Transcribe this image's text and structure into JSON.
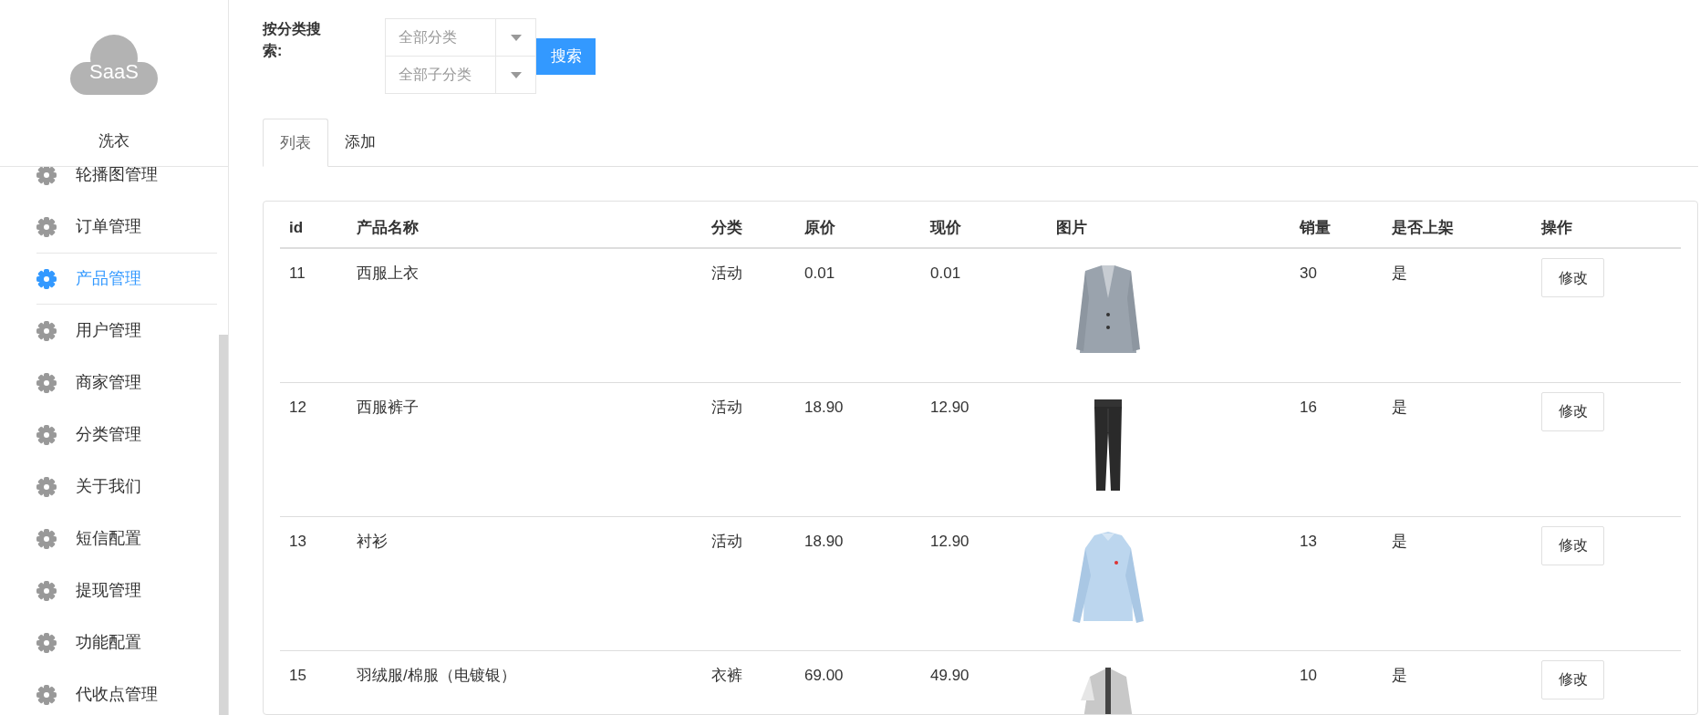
{
  "sidebar": {
    "logo_text": "SaaS",
    "brand": "洗衣",
    "items": [
      {
        "label": "轮播图管理",
        "selected": false
      },
      {
        "label": "订单管理",
        "selected": false
      },
      {
        "label": "产品管理",
        "selected": true
      },
      {
        "label": "用户管理",
        "selected": false
      },
      {
        "label": "商家管理",
        "selected": false
      },
      {
        "label": "分类管理",
        "selected": false
      },
      {
        "label": "关于我们",
        "selected": false
      },
      {
        "label": "短信配置",
        "selected": false
      },
      {
        "label": "提现管理",
        "selected": false
      },
      {
        "label": "功能配置",
        "selected": false
      },
      {
        "label": "代收点管理",
        "selected": false
      }
    ]
  },
  "search": {
    "label": "按分类搜索:",
    "selects": [
      {
        "value": "全部分类"
      },
      {
        "value": "全部子分类"
      }
    ],
    "button": "搜索"
  },
  "tabs": [
    {
      "label": "列表",
      "selected": true
    },
    {
      "label": "添加",
      "selected": false
    }
  ],
  "table": {
    "columns": [
      "id",
      "产品名称",
      "分类",
      "原价",
      "现价",
      "图片",
      "销量",
      "是否上架",
      "操作"
    ],
    "rows": [
      {
        "id": "11",
        "name": "西服上衣",
        "category": "活动",
        "original_price": "0.01",
        "price": "0.01",
        "sales": "30",
        "on_shelf": "是",
        "action": "修改"
      },
      {
        "id": "12",
        "name": "西服裤子",
        "category": "活动",
        "original_price": "18.90",
        "price": "12.90",
        "sales": "16",
        "on_shelf": "是",
        "action": "修改"
      },
      {
        "id": "13",
        "name": "衬衫",
        "category": "活动",
        "original_price": "18.90",
        "price": "12.90",
        "sales": "13",
        "on_shelf": "是",
        "action": "修改"
      },
      {
        "id": "15",
        "name": "羽绒服/棉服（电镀银）",
        "category": "衣裤",
        "original_price": "69.00",
        "price": "49.90",
        "sales": "10",
        "on_shelf": "是",
        "action": "修改"
      }
    ]
  }
}
